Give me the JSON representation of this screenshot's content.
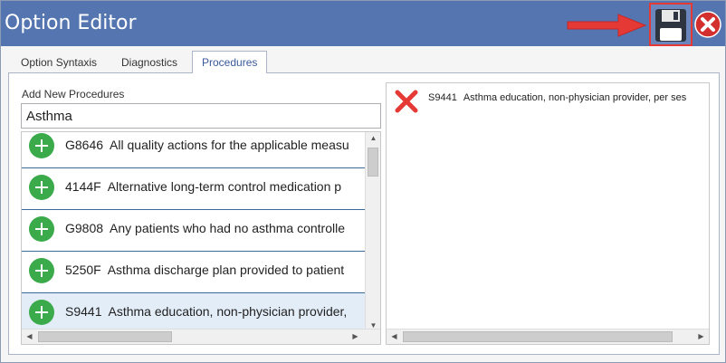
{
  "window": {
    "title": "Option Editor",
    "accent_color": "#5475b0",
    "save_icon": "floppy-disk-icon",
    "close_icon": "close-circle-icon",
    "annotation_icon": "red-arrow-icon"
  },
  "tabs": [
    {
      "label": "Option Syntaxis",
      "active": false
    },
    {
      "label": "Diagnostics",
      "active": false
    },
    {
      "label": "Procedures",
      "active": true
    }
  ],
  "procedures": {
    "add_label": "Add New Procedures",
    "search_value": "Asthma",
    "add_icon": "plus-circle-icon",
    "items": [
      {
        "code": "G8646",
        "desc": "All quality actions for the applicable measu"
      },
      {
        "code": "4144F",
        "desc": "Alternative long-term control medication p"
      },
      {
        "code": "G9808",
        "desc": "Any patients who had no asthma controlle"
      },
      {
        "code": "5250F",
        "desc": "Asthma discharge plan provided to patient"
      },
      {
        "code": "S9441",
        "desc": "Asthma education, non-physician provider,",
        "selected": true
      }
    ],
    "selected_items": [
      {
        "code": "S9441",
        "desc": "Asthma education, non-physician provider, per ses",
        "remove_icon": "remove-x-icon"
      }
    ]
  }
}
